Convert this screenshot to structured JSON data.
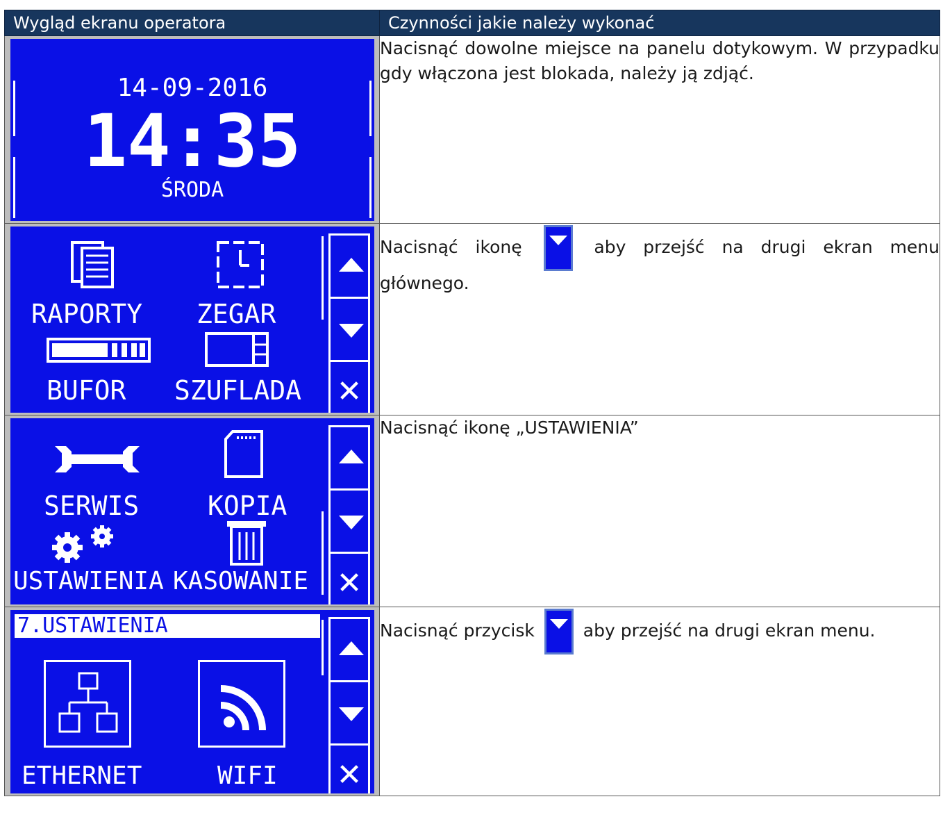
{
  "header": {
    "col1": "Wygląd ekranu operatora",
    "col2": "Czynności jakie należy wykonać"
  },
  "rows": [
    {
      "screen": {
        "date": "14-09-2016",
        "time": "14:35",
        "day": "ŚRODA"
      },
      "text": "Nacisnąć dowolne miejsce na panelu dotykowym. W przypadku gdy włączona jest blokada, należy ją zdjąć."
    },
    {
      "screen": {
        "items": [
          "RAPORTY",
          "ZEGAR",
          "BUFOR",
          "SZUFLADA"
        ]
      },
      "text_before": "Nacisnąć ikonę",
      "text_after": "aby przejść na drugi ekran menu głównego."
    },
    {
      "screen": {
        "items": [
          "SERWIS",
          "KOPIA",
          "USTAWIENIA",
          "KASOWANIE"
        ]
      },
      "text": "Nacisnąć ikonę „USTAWIENIA”"
    },
    {
      "screen": {
        "title": "7.USTAWIENIA",
        "items": [
          "ETHERNET",
          "WIFI"
        ]
      },
      "text_before": "Nacisnąć przycisk",
      "text_after": "aby przejść na drugi ekran menu."
    }
  ],
  "colors": {
    "header_bg": "#17365D",
    "screen_bg": "#0A10E6"
  }
}
